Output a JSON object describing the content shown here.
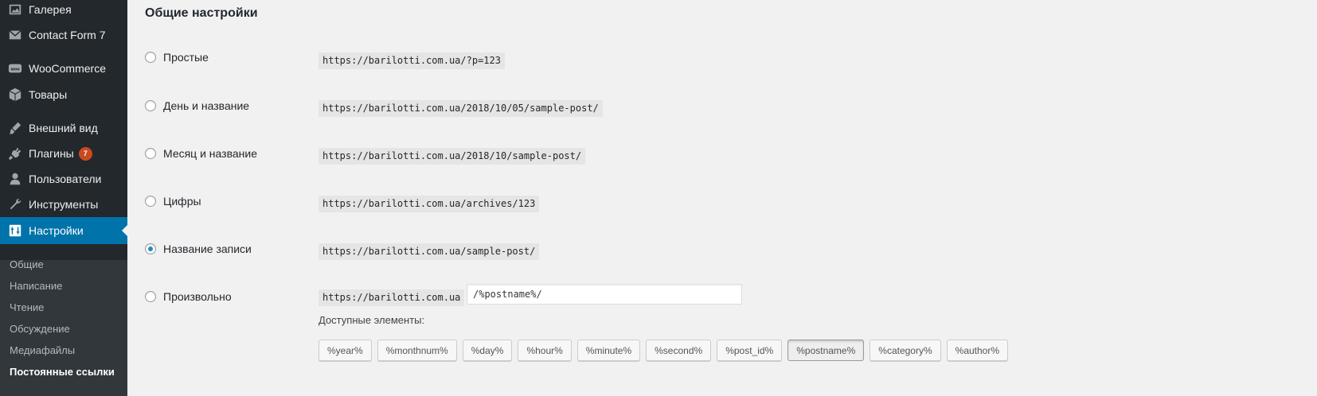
{
  "sidebar": {
    "items": [
      {
        "label": "Галерея",
        "icon": "gallery-icon"
      },
      {
        "label": "Contact Form 7",
        "icon": "mail-icon"
      },
      {
        "label": "WooCommerce",
        "icon": "woocommerce-icon"
      },
      {
        "label": "Товары",
        "icon": "box-icon"
      },
      {
        "label": "Внешний вид",
        "icon": "brush-icon"
      },
      {
        "label": "Плагины",
        "icon": "plugin-icon",
        "badge": "7"
      },
      {
        "label": "Пользователи",
        "icon": "user-icon"
      },
      {
        "label": "Инструменты",
        "icon": "wrench-icon"
      },
      {
        "label": "Настройки",
        "icon": "settings-icon",
        "active": true
      }
    ],
    "submenu": [
      {
        "label": "Общие"
      },
      {
        "label": "Написание"
      },
      {
        "label": "Чтение"
      },
      {
        "label": "Обсуждение"
      },
      {
        "label": "Медиафайлы"
      },
      {
        "label": "Постоянные ссылки",
        "current": true
      }
    ]
  },
  "main": {
    "section_title": "Общие настройки",
    "options": [
      {
        "label": "Простые",
        "example": "https://barilotti.com.ua/?p=123",
        "checked": false
      },
      {
        "label": "День и название",
        "example": "https://barilotti.com.ua/2018/10/05/sample-post/",
        "checked": false
      },
      {
        "label": "Месяц и название",
        "example": "https://barilotti.com.ua/2018/10/sample-post/",
        "checked": false
      },
      {
        "label": "Цифры",
        "example": "https://barilotti.com.ua/archives/123",
        "checked": false
      },
      {
        "label": "Название записи",
        "example": "https://barilotti.com.ua/sample-post/",
        "checked": true
      },
      {
        "label": "Произвольно",
        "example": "https://barilotti.com.ua",
        "checked": false
      }
    ],
    "custom_structure_value": "/%postname%/",
    "available_label": "Доступные элементы:",
    "tags": [
      "%year%",
      "%monthnum%",
      "%day%",
      "%hour%",
      "%minute%",
      "%second%",
      "%post_id%",
      "%postname%",
      "%category%",
      "%author%"
    ],
    "pressed_tag": "%postname%"
  },
  "colors": {
    "sidebar_bg": "#23282d",
    "submenu_bg": "#32373c",
    "accent": "#0073aa",
    "badge": "#ca4a1f",
    "page_bg": "#f1f1f1"
  }
}
